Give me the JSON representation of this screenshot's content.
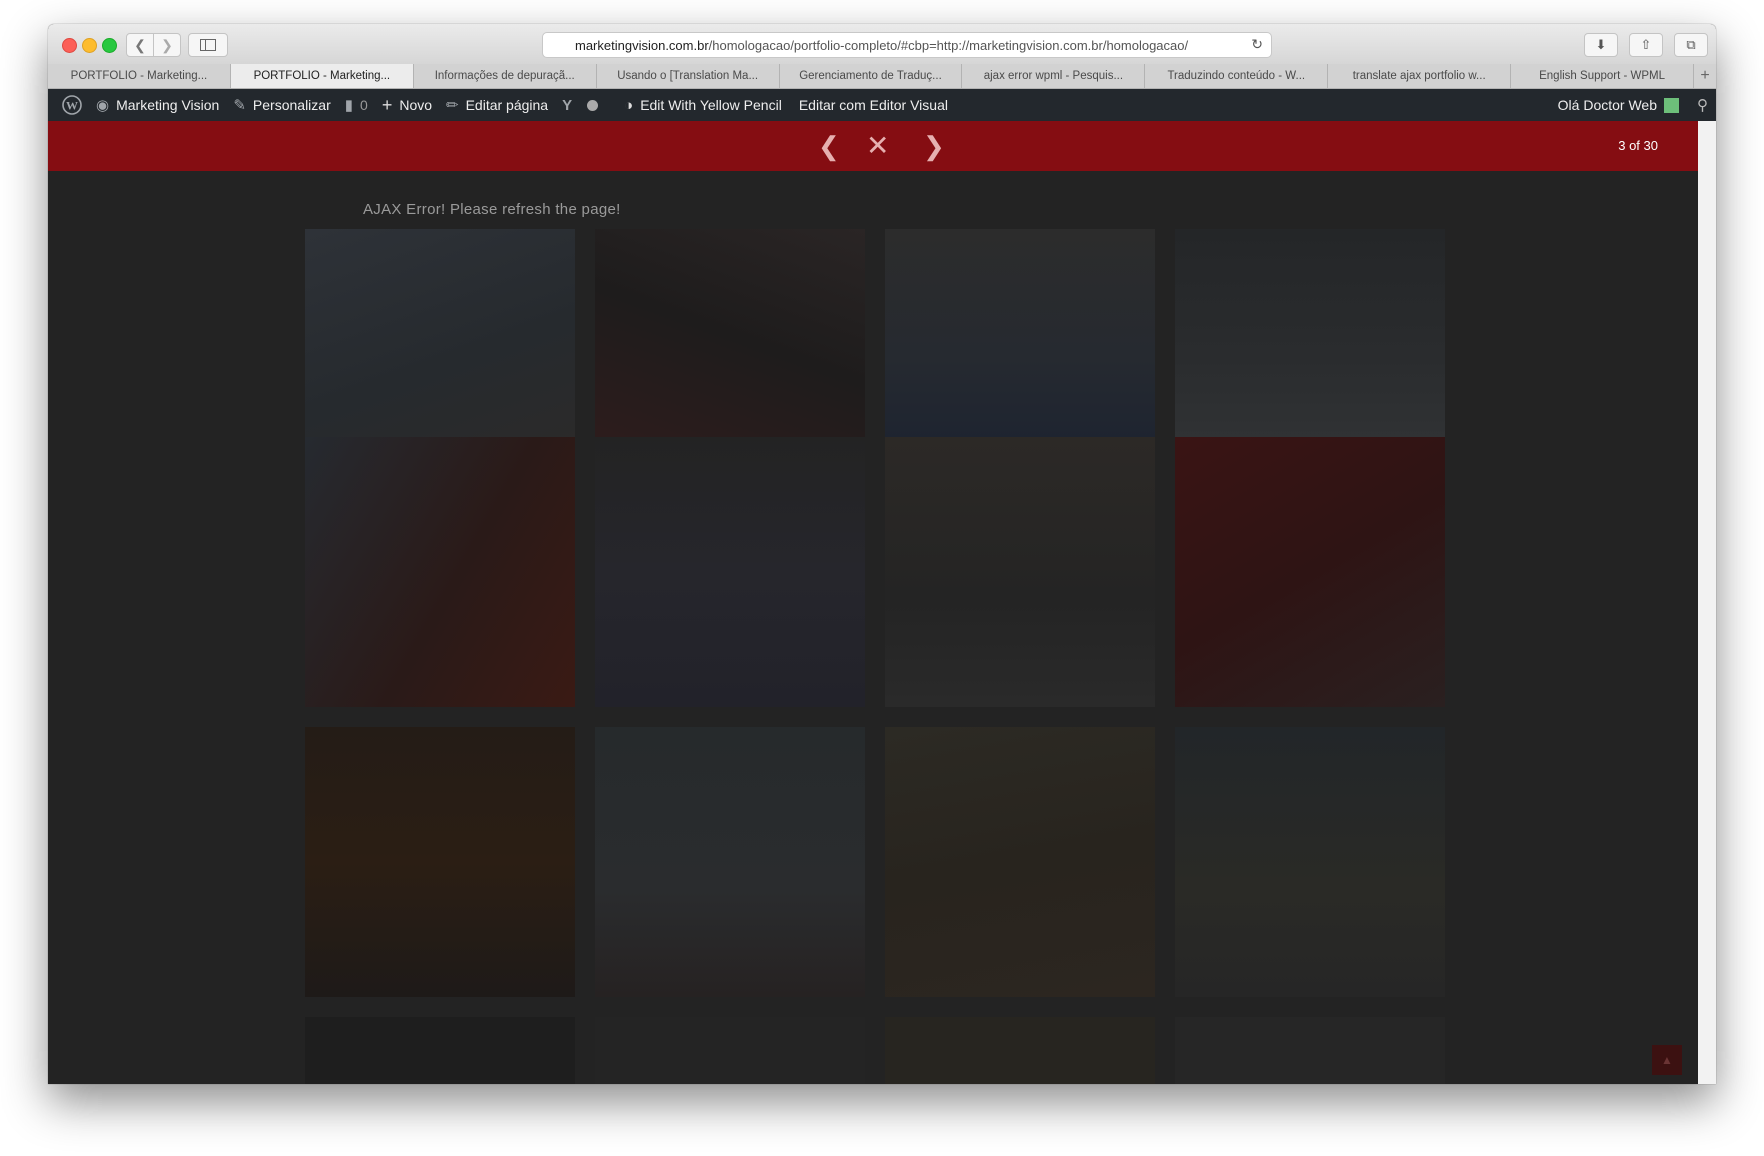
{
  "browser": {
    "url_host": "marketingvision.com.br",
    "url_rest": "/homologacao/portfolio-completo/#cbp=http://marketingvision.com.br/homologacao/",
    "tabs": [
      {
        "label": "PORTFOLIO - Marketing...",
        "active": false
      },
      {
        "label": "PORTFOLIO - Marketing...",
        "active": true
      },
      {
        "label": "Informações de depuraçã...",
        "active": false
      },
      {
        "label": "Usando o [Translation Ma...",
        "active": false
      },
      {
        "label": "Gerenciamento de Traduç...",
        "active": false
      },
      {
        "label": "ajax error wpml - Pesquis...",
        "active": false
      },
      {
        "label": "Traduzindo conteúdo - W...",
        "active": false
      },
      {
        "label": "translate ajax portfolio w...",
        "active": false
      },
      {
        "label": "English Support - WPML",
        "active": false
      }
    ]
  },
  "adminbar": {
    "site_name": "Marketing Vision",
    "customize": "Personalizar",
    "comments_count": "0",
    "new": "Novo",
    "edit_page": "Editar página",
    "yellow_pencil": "Edit With Yellow Pencil",
    "visual_editor": "Editar com Editor Visual",
    "greeting": "Olá Doctor Web"
  },
  "lightbox": {
    "counter": "3 of 30",
    "error_message": "AJAX Error! Please refresh the page!"
  },
  "colors": {
    "header_red": "#850d12",
    "adminbar": "#23282d",
    "overlay": "#232323"
  },
  "icons": {
    "prev": "chevron-left-icon",
    "close": "close-icon",
    "next": "chevron-right-icon"
  }
}
